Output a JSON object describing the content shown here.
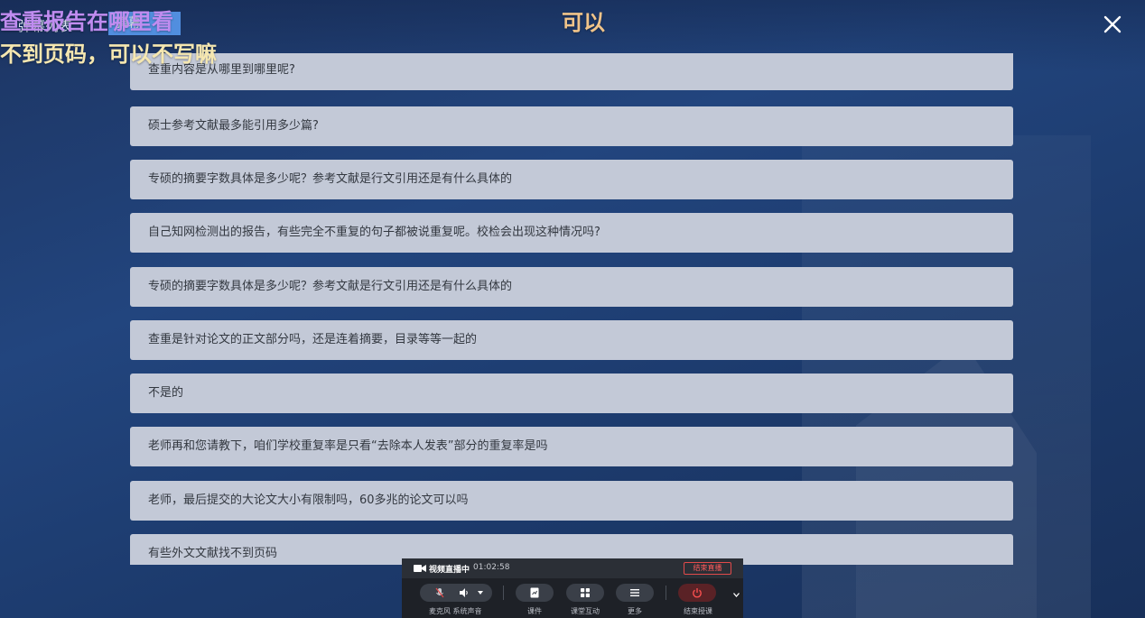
{
  "topbar": {
    "tab_danmaku_list": "弹幕列表",
    "tab_active": "弹幕",
    "danmaku_1": "查重报告在哪里看",
    "danmaku_2": "不到页码，可以不写嘛",
    "danmaku_3": "可以",
    "close_icon": "close-icon"
  },
  "questions": [
    "查重内容是从哪里到哪里呢?",
    "硕士参考文献最多能引用多少篇?",
    "专硕的摘要字数具体是多少呢？参考文献是行文引用还是有什么具体的",
    "自己知网检测出的报告，有些完全不重复的句子都被说重复呢。校检会出现这种情况吗?",
    "专硕的摘要字数具体是多少呢？参考文献是行文引用还是有什么具体的",
    "查重是针对论文的正文部分吗，还是连着摘要，目录等等一起的",
    "不是的",
    "老师再和您请教下，咱们学校重复率是只看“去除本人发表”部分的重复率是吗",
    "老师，最后提交的大论文大小有限制吗，60多兆的论文可以吗",
    "有些外文文献找不到页码"
  ],
  "live": {
    "status": "视频直播中",
    "time": "01:02:58",
    "end_live_label": "结束直播",
    "controls": [
      {
        "label": "麦克风 系统声音",
        "icon": "mic-speaker-icon"
      },
      {
        "label": "课件",
        "icon": "courseware-icon"
      },
      {
        "label": "课堂互动",
        "icon": "grid-icon"
      },
      {
        "label": "更多",
        "icon": "menu-icon"
      },
      {
        "label": "结束授课",
        "icon": "power-icon"
      }
    ]
  },
  "colors": {
    "background": "#1f3d70",
    "list_item": "#c3c9d7",
    "active_tab": "#5b9ff5",
    "end_red": "#e24a4a"
  }
}
